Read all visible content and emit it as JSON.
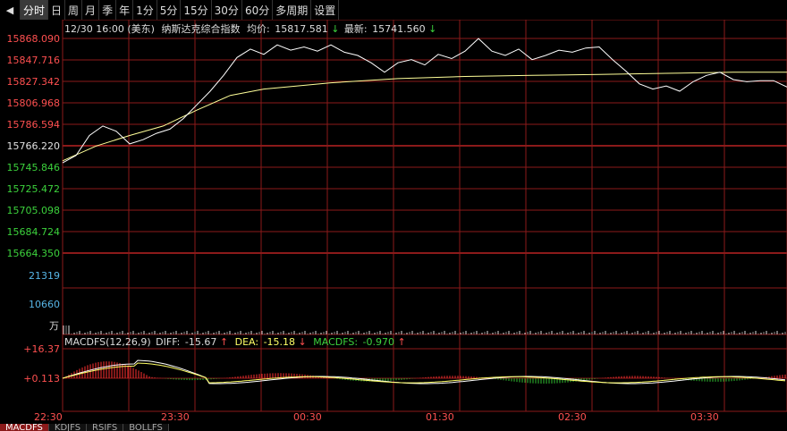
{
  "toolbar": {
    "back_icon": "back-arrow-icon",
    "tabs": [
      "分时",
      "日",
      "周",
      "月",
      "季",
      "年",
      "1分",
      "5分",
      "15分",
      "30分",
      "60分",
      "多周期",
      "设置"
    ],
    "active_index": 0
  },
  "header": {
    "datetime": "12/30 16:00 (美东)",
    "name": "纳斯达克综合指数",
    "avg_label": "均价:",
    "avg_value": "15817.581",
    "avg_dir": "↓",
    "latest_label": "最新:",
    "latest_value": "15741.560",
    "latest_dir": "↓"
  },
  "price_axis": {
    "ticks": [
      "15868.090",
      "15847.716",
      "15827.342",
      "15806.968",
      "15786.594",
      "15766.220",
      "15745.846",
      "15725.472",
      "15705.098",
      "15684.724",
      "15664.350"
    ],
    "ref_index": 5,
    "colors": {
      "up": "#ff5050",
      "ref": "#e0e0e0",
      "down": "#3cd23c"
    }
  },
  "volume_axis": {
    "ticks": [
      "21319",
      "10660"
    ],
    "unit": "万",
    "color": "#57b5e6"
  },
  "macd": {
    "title": "MACDFS(12,26,9)",
    "diff_label": "DIFF:",
    "diff_value": "-15.67",
    "diff_dir": "↑",
    "dea_label": "DEA:",
    "dea_value": "-15.18",
    "dea_dir": "↓",
    "macdfs_label": "MACDFS:",
    "macdfs_value": "-0.970",
    "macdfs_dir": "↑",
    "ticks": [
      "+16.37",
      "+0.113"
    ]
  },
  "time_axis": {
    "ticks": [
      "22:30",
      "23:30",
      "00:30",
      "01:30",
      "02:30",
      "03:30"
    ]
  },
  "bottom_tabs": [
    "MACDFS",
    "KDJFS",
    "RSIFS",
    "BOLLFS"
  ],
  "bottom_active": 0,
  "colors": {
    "grid": "#8b1a1a",
    "price_line": "#ffffff",
    "avg_line": "#ffff99",
    "bar_up": "#ff3030",
    "bar_down": "#30c030",
    "diff_line": "#ffffff",
    "dea_line": "#ffff66"
  },
  "chart_data": {
    "type": "line",
    "x_ticks": [
      "22:30",
      "23:30",
      "00:30",
      "01:30",
      "02:30",
      "03:30"
    ],
    "ylim": [
      15664.35,
      15868.09
    ],
    "price_series": [
      [
        0,
        15750
      ],
      [
        2,
        15757
      ],
      [
        4,
        15776
      ],
      [
        6,
        15785
      ],
      [
        8,
        15780
      ],
      [
        10,
        15768
      ],
      [
        12,
        15772
      ],
      [
        14,
        15778
      ],
      [
        16,
        15782
      ],
      [
        18,
        15792
      ],
      [
        20,
        15805
      ],
      [
        22,
        15818
      ],
      [
        24,
        15833
      ],
      [
        26,
        15850
      ],
      [
        28,
        15858
      ],
      [
        30,
        15853
      ],
      [
        32,
        15862
      ],
      [
        34,
        15857
      ],
      [
        36,
        15860
      ],
      [
        38,
        15856
      ],
      [
        40,
        15862
      ],
      [
        42,
        15855
      ],
      [
        44,
        15852
      ],
      [
        46,
        15845
      ],
      [
        48,
        15836
      ],
      [
        50,
        15845
      ],
      [
        52,
        15848
      ],
      [
        54,
        15843
      ],
      [
        56,
        15853
      ],
      [
        58,
        15849
      ],
      [
        60,
        15856
      ],
      [
        62,
        15868
      ],
      [
        64,
        15856
      ],
      [
        66,
        15852
      ],
      [
        68,
        15858
      ],
      [
        70,
        15848
      ],
      [
        72,
        15852
      ],
      [
        74,
        15857
      ],
      [
        76,
        15855
      ],
      [
        78,
        15859
      ],
      [
        80,
        15860
      ],
      [
        82,
        15848
      ],
      [
        84,
        15837
      ],
      [
        86,
        15825
      ],
      [
        88,
        15820
      ],
      [
        90,
        15823
      ],
      [
        92,
        15818
      ],
      [
        94,
        15827
      ],
      [
        96,
        15833
      ],
      [
        98,
        15836
      ],
      [
        100,
        15829
      ],
      [
        102,
        15827
      ],
      [
        104,
        15828
      ],
      [
        106,
        15828
      ],
      [
        108,
        15822
      ]
    ],
    "avg_series": [
      [
        0,
        15752
      ],
      [
        5,
        15766
      ],
      [
        10,
        15776
      ],
      [
        15,
        15785
      ],
      [
        20,
        15800
      ],
      [
        25,
        15814
      ],
      [
        30,
        15820
      ],
      [
        40,
        15826
      ],
      [
        50,
        15830
      ],
      [
        60,
        15832
      ],
      [
        70,
        15833
      ],
      [
        80,
        15834
      ],
      [
        90,
        15835
      ],
      [
        100,
        15836
      ],
      [
        108,
        15836
      ]
    ]
  }
}
